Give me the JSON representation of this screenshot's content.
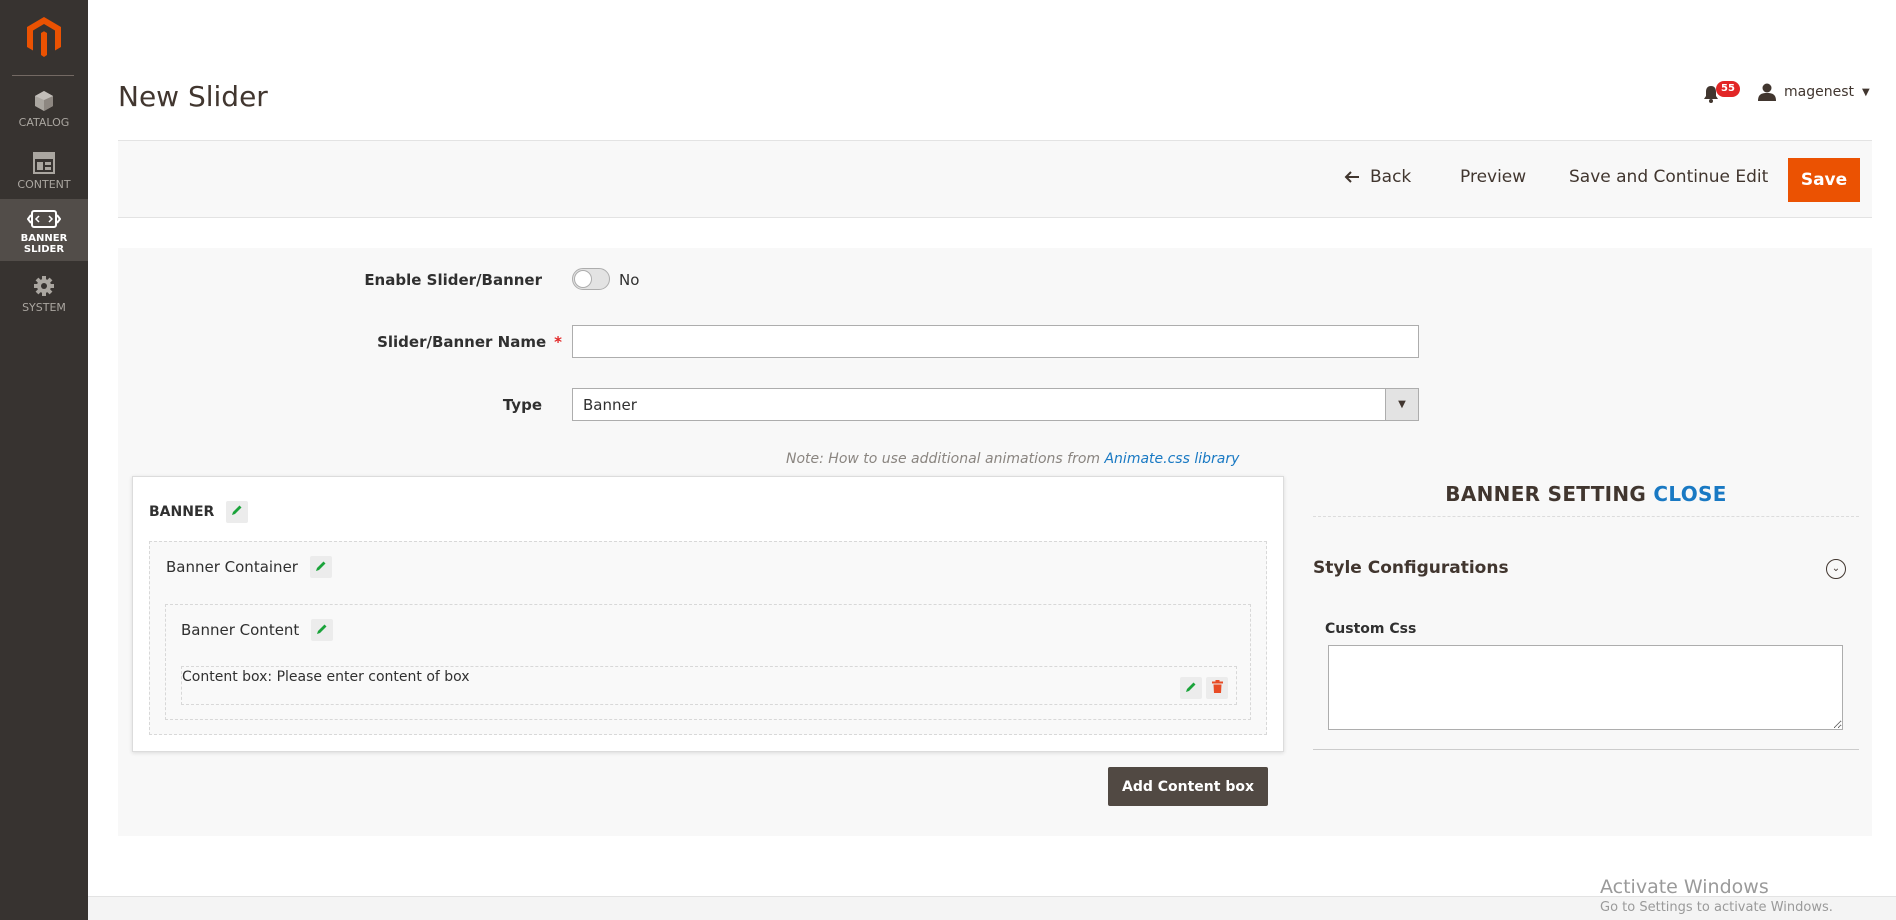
{
  "sidebar": {
    "items": [
      {
        "label": "CATALOG",
        "icon": "cube-icon"
      },
      {
        "label": "CONTENT",
        "icon": "layout-icon"
      },
      {
        "label": "BANNER SLIDER",
        "icon": "slider-icon",
        "active": true
      },
      {
        "label": "SYSTEM",
        "icon": "gear-icon"
      }
    ]
  },
  "header": {
    "title": "New Slider",
    "notifications_count": "55",
    "username": "magenest"
  },
  "actions": {
    "back": "Back",
    "preview": "Preview",
    "save_continue": "Save and Continue Edit",
    "save": "Save"
  },
  "form": {
    "enable_label": "Enable Slider/Banner",
    "enable_value": "No",
    "name_label": "Slider/Banner Name",
    "name_required": "*",
    "name_value": "",
    "type_label": "Type",
    "type_value": "Banner",
    "note_prefix": "Note: How to use additional animations from ",
    "note_link": "Animate.css library"
  },
  "editor": {
    "banner_title": "BANNER",
    "container_title": "Banner Container",
    "content_title": "Banner Content",
    "content_box_text": "Content box: Please enter content of box",
    "add_button": "Add Content box"
  },
  "settings": {
    "title": "BANNER SETTING",
    "close": "CLOSE",
    "section_title": "Style Configurations",
    "custom_css_label": "Custom Css",
    "custom_css_value": ""
  },
  "watermark": {
    "title": "Activate Windows",
    "subtitle": "Go to Settings to activate Windows."
  },
  "colors": {
    "sidebar_bg": "#373330",
    "accent": "#eb5202",
    "link": "#1979c3",
    "edit_icon": "#1aa33a",
    "delete_icon": "#e84b25"
  }
}
